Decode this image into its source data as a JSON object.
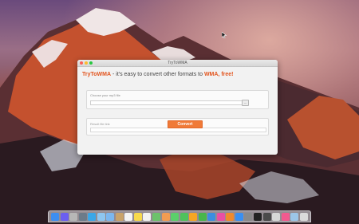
{
  "window": {
    "title": "TryToWMA",
    "brand": "TryToWMA",
    "tagline": " - it's easy to convert other formats to ",
    "tagline_link": "WMA, free!"
  },
  "file_panel": {
    "label": "Choose your mp3 file",
    "input_value": "",
    "input_placeholder": "",
    "browse_label": "..."
  },
  "result_panel": {
    "label": "Result file link",
    "convert_label": "Convert"
  },
  "dock": {
    "icons": [
      {
        "name": "finder-icon",
        "color": "#3d8ef0"
      },
      {
        "name": "siri-icon",
        "color": "#6b5ff0"
      },
      {
        "name": "launchpad-icon",
        "color": "#b7b7b7"
      },
      {
        "name": "system-tool-icon",
        "color": "#6c7b8a"
      },
      {
        "name": "safari-icon",
        "color": "#3aa7e8"
      },
      {
        "name": "photos-app-icon",
        "color": "#8ec6ef"
      },
      {
        "name": "mail-icon",
        "color": "#7cb7ee"
      },
      {
        "name": "contacts-icon",
        "color": "#c9a36a"
      },
      {
        "name": "calendar-icon",
        "color": "#f4f4f4"
      },
      {
        "name": "notes-icon",
        "color": "#f7d94c"
      },
      {
        "name": "reminders-icon",
        "color": "#f2f2f2"
      },
      {
        "name": "maps-icon",
        "color": "#6cc26b"
      },
      {
        "name": "photos-icon",
        "color": "#f29c52"
      },
      {
        "name": "messages-icon",
        "color": "#5bcf6a"
      },
      {
        "name": "facetime-icon",
        "color": "#4fc25c"
      },
      {
        "name": "pages-icon",
        "color": "#f5a623"
      },
      {
        "name": "numbers-icon",
        "color": "#48b64b"
      },
      {
        "name": "keynote-icon",
        "color": "#3b8ee0"
      },
      {
        "name": "itunes-icon",
        "color": "#e94fa3"
      },
      {
        "name": "ibooks-icon",
        "color": "#f08a2c"
      },
      {
        "name": "app-store-icon",
        "color": "#3a8ff0"
      },
      {
        "name": "system-preferences-icon",
        "color": "#8a8a8a"
      },
      {
        "name": "terminal-icon",
        "color": "#222222"
      },
      {
        "name": "activity-monitor-icon",
        "color": "#4a4a4a"
      },
      {
        "name": "downloads-icon",
        "color": "#d7d7d7"
      },
      {
        "name": "itunes-store-icon",
        "color": "#f25a8f"
      },
      {
        "name": "folder-icon",
        "color": "#9cc6e8"
      },
      {
        "name": "trash-icon",
        "color": "#dadada"
      }
    ]
  }
}
